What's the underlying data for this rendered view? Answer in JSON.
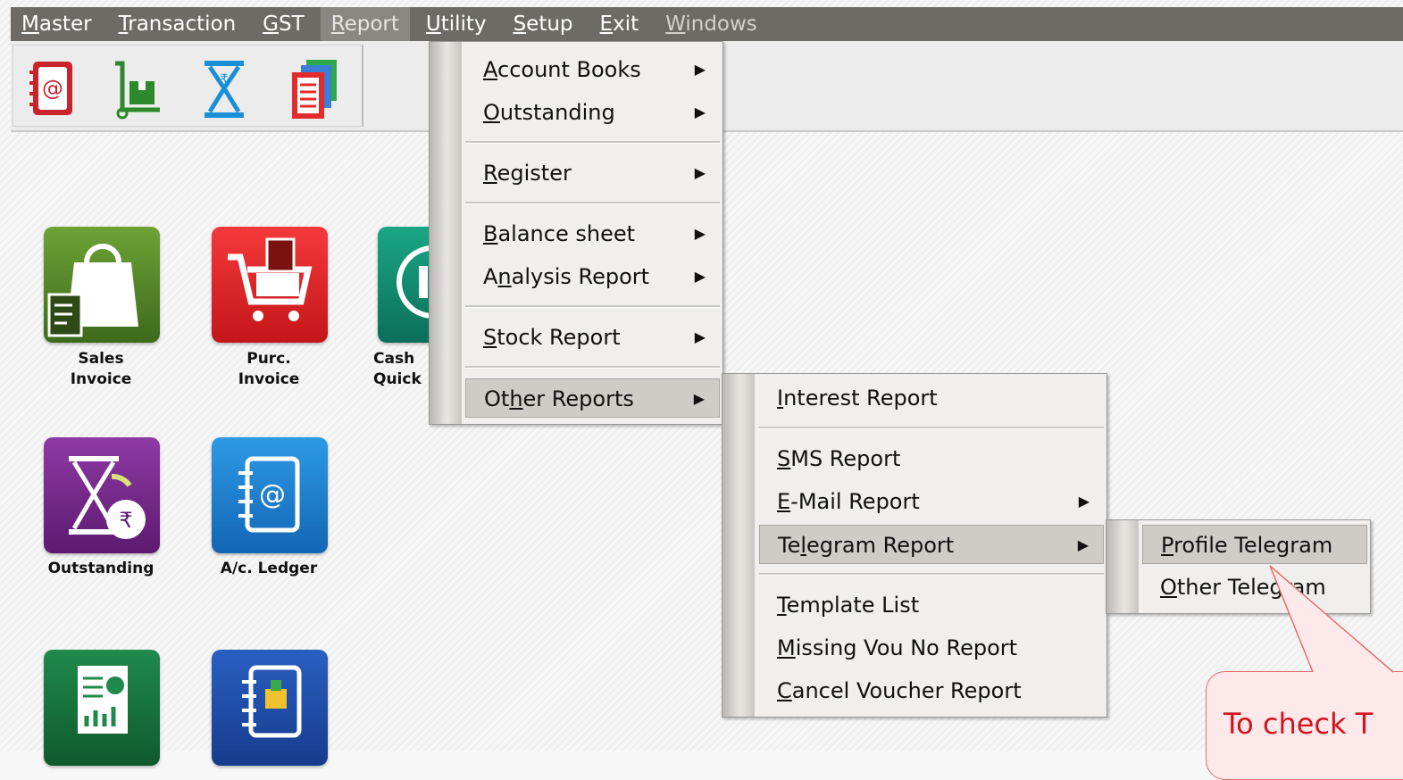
{
  "menubar": {
    "items": [
      {
        "label": "Master",
        "u": "M",
        "rest": "aster"
      },
      {
        "label": "Transaction",
        "u": "T",
        "rest": "ransaction"
      },
      {
        "label": "GST",
        "u": "G",
        "rest": "ST"
      },
      {
        "label": "Report",
        "u": "R",
        "rest": "eport"
      },
      {
        "label": "Utility",
        "u": "U",
        "rest": "tility"
      },
      {
        "label": "Setup",
        "u": "S",
        "rest": "etup"
      },
      {
        "label": "Exit",
        "u": "E",
        "rest": "xit"
      },
      {
        "label": "Windows",
        "u": "W",
        "rest": "indows"
      }
    ],
    "active": "Report",
    "disabled": "Windows"
  },
  "toolbar": {
    "icons": [
      "ledger-book-icon",
      "trolley-box-icon",
      "rupee-hourglass-icon",
      "documents-stack-icon"
    ]
  },
  "tiles": [
    {
      "line1": "Sales",
      "line2": "Invoice",
      "icon": "shopping-bag-icon",
      "color": "#5a8a2a"
    },
    {
      "line1": "Purc.",
      "line2": "Invoice",
      "icon": "cart-icon",
      "color": "#e51e22"
    },
    {
      "line1": "Cash",
      "line2": "Quick",
      "icon": "bank-coin-icon",
      "color": "#0c8f74"
    },
    {
      "line1": "Outstanding",
      "line2": "",
      "icon": "hourglass-rupee-icon",
      "color": "#7a2a8e"
    },
    {
      "line1": "A/c. Ledger",
      "line2": "",
      "icon": "address-book-icon",
      "color": "#1f7fcf"
    },
    {
      "line1": "",
      "line2": "",
      "icon": "report-chart-icon",
      "color": "#1b6d3c"
    },
    {
      "line1": "",
      "line2": "",
      "icon": "stock-book-icon",
      "color": "#1e4fa8"
    }
  ],
  "report_menu": {
    "items": [
      {
        "pre": "",
        "u": "A",
        "post": "ccount Books"
      },
      {
        "pre": "",
        "u": "O",
        "post": "utstanding"
      },
      {
        "pre": "",
        "u": "R",
        "post": "egister"
      },
      {
        "pre": "",
        "u": "B",
        "post": "alance sheet"
      },
      {
        "pre": "A",
        "u": "n",
        "post": "alysis Report"
      },
      {
        "pre": "",
        "u": "S",
        "post": "tock Report"
      },
      {
        "pre": "Ot",
        "u": "h",
        "post": "er Reports"
      }
    ]
  },
  "other_reports_menu": {
    "items": [
      {
        "pre": "",
        "u": "I",
        "post": "nterest Report"
      },
      {
        "pre": "",
        "u": "S",
        "post": "MS Report"
      },
      {
        "pre": "",
        "u": "E",
        "post": "-Mail Report"
      },
      {
        "pre": "Te",
        "u": "l",
        "post": "egram Report"
      },
      {
        "pre": "",
        "u": "T",
        "post": "emplate List"
      },
      {
        "pre": "",
        "u": "M",
        "post": "issing Vou No Report"
      },
      {
        "pre": "",
        "u": "C",
        "post": "ancel Voucher Report"
      }
    ]
  },
  "telegram_menu": {
    "items": [
      {
        "pre": "",
        "u": "P",
        "post": "rofile Telegram"
      },
      {
        "pre": "",
        "u": "O",
        "post": "ther Telegram"
      }
    ]
  },
  "callout": {
    "text": "To check T"
  }
}
